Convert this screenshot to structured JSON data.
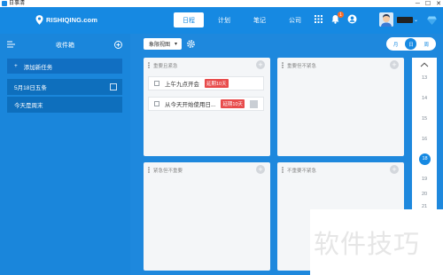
{
  "window": {
    "title": "日事清",
    "controls": [
      "─",
      "☐",
      "✕"
    ]
  },
  "header": {
    "brand": "RISHIQING.com",
    "tabs": [
      {
        "label": "日程",
        "active": true
      },
      {
        "label": "计划",
        "active": false
      },
      {
        "label": "笔记",
        "active": false
      },
      {
        "label": "公司",
        "active": false
      }
    ],
    "notification_count": "1",
    "accent": "#1689e2"
  },
  "sidebar": {
    "title": "收件箱",
    "add_task_label": "添加新任务",
    "items": [
      {
        "label": "5月18日五条"
      },
      {
        "label": "今天是周末"
      }
    ]
  },
  "toolbar": {
    "view_selector": "象限视图"
  },
  "modes": [
    {
      "label": "月",
      "active": false
    },
    {
      "label": "日",
      "active": true
    },
    {
      "label": "周",
      "active": false
    }
  ],
  "quadrants": [
    {
      "title": "重要且紧急",
      "tasks": [
        {
          "label": "上午九点开会",
          "overdue": "延期10天"
        },
        {
          "label": "从今天开始使用日...",
          "overdue": "延期10天"
        }
      ]
    },
    {
      "title": "重要但不紧急",
      "tasks": []
    },
    {
      "title": "紧急但不重要",
      "tasks": []
    },
    {
      "title": "不重要不紧急",
      "tasks": []
    }
  ],
  "dates": [
    "13",
    "14",
    "15",
    "16",
    "17",
    "18",
    "19",
    "20",
    "21"
  ],
  "selected_date": "18",
  "watermark": "软件技巧",
  "colors": {
    "overdue": "#e84b4b",
    "sidebar": "#1a86db",
    "main_bg": "#1e88dd"
  }
}
